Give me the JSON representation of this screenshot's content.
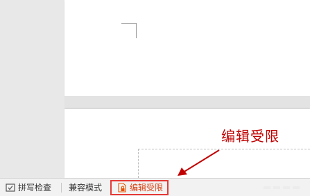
{
  "annotation": {
    "label": "编辑受限"
  },
  "statusbar": {
    "spell_check": {
      "label": "拼写检查",
      "icon": "spell-check-icon"
    },
    "compat_mode": {
      "label": "兼容模式"
    },
    "edit_restrict": {
      "label": "编辑受限",
      "icon": "lock-document-icon"
    }
  },
  "colors": {
    "annotation_red": "#c00000",
    "highlight_border": "#e53935",
    "restrict_text": "#d84315",
    "page_background": "#ffffff",
    "canvas_background": "#e8e8e8"
  }
}
